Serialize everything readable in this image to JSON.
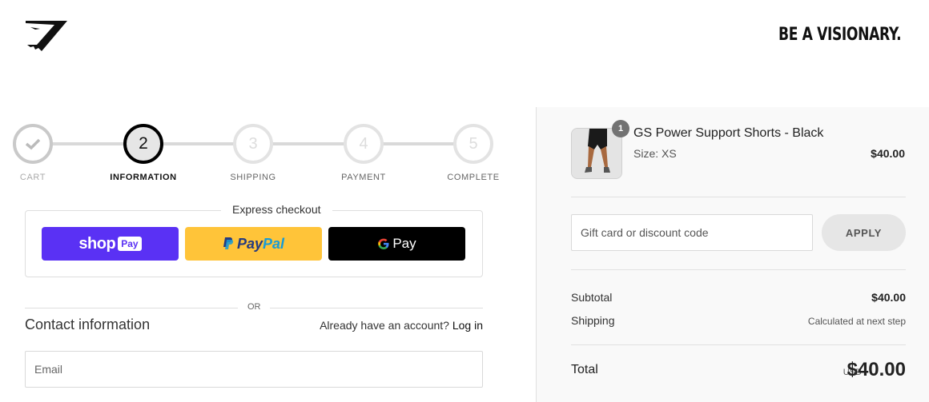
{
  "header": {
    "logo": "gymshark-logo-icon",
    "tagline": "BE A VISIONARY."
  },
  "steps": [
    {
      "number": "✓",
      "label": "CART",
      "state": "done"
    },
    {
      "number": "2",
      "label": "INFORMATION",
      "state": "active"
    },
    {
      "number": "3",
      "label": "SHIPPING",
      "state": "pending"
    },
    {
      "number": "4",
      "label": "PAYMENT",
      "state": "pending"
    },
    {
      "number": "5",
      "label": "COMPLETE",
      "state": "pending"
    }
  ],
  "express": {
    "title": "Express checkout",
    "shop_pay": {
      "word": "shop",
      "badge": "Pay",
      "color": "#5a31f4"
    },
    "paypal": {
      "word1": "Pay",
      "word2": "Pal",
      "color": "#ffc439"
    },
    "gpay": {
      "word": "Pay",
      "color": "#000000"
    }
  },
  "divider_or": "OR",
  "contact": {
    "title": "Contact information",
    "account_prompt": "Already have an account?",
    "login_link": "Log in",
    "email_placeholder": "Email"
  },
  "summary": {
    "product": {
      "name": "GS Power Support Shorts - Black",
      "size": "Size: XS",
      "price": "$40.00",
      "quantity": "1"
    },
    "discount_placeholder": "Gift card or discount code",
    "apply_label": "APPLY",
    "subtotal_label": "Subtotal",
    "subtotal_value": "$40.00",
    "shipping_label": "Shipping",
    "shipping_value": "Calculated at next step",
    "total_label": "Total",
    "currency": "USD",
    "total_value": "$40.00"
  }
}
